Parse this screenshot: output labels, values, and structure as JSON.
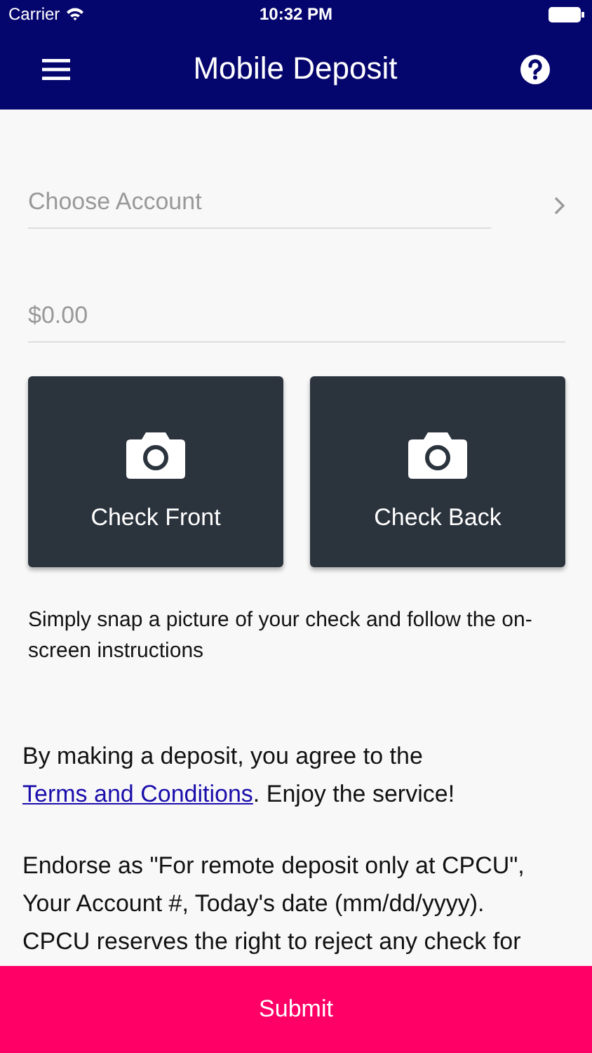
{
  "status_bar": {
    "carrier": "Carrier",
    "time": "10:32 PM"
  },
  "nav_bar": {
    "title": "Mobile Deposit"
  },
  "account_field": {
    "placeholder": "Choose Account"
  },
  "amount_field": {
    "placeholder": "$0.00"
  },
  "capture_buttons": [
    {
      "label": "Check Front"
    },
    {
      "label": "Check Back"
    }
  ],
  "instructions": "Simply snap a picture of your check and follow the on-screen instructions",
  "agreement": {
    "before": "By making a deposit, you agree to the ",
    "link": "Terms and Conditions",
    "after": ". Enjoy the service!"
  },
  "endorsement": "Endorse as \"For remote deposit only at CPCU\", Your Account #, Today's date (mm/dd/yyyy). CPCU reserves the right to reject any check for",
  "submit_button": {
    "label": "Submit"
  }
}
